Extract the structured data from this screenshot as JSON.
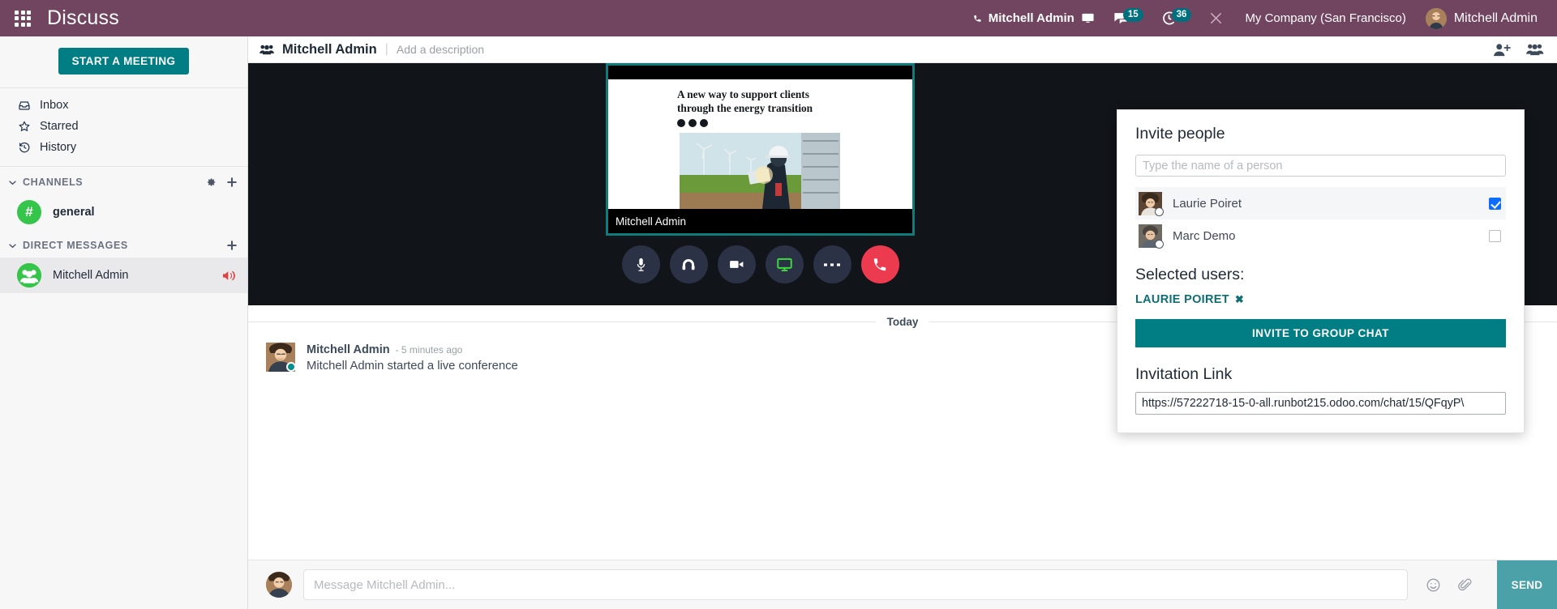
{
  "navbar": {
    "apps_icon": "apps-grid-icon",
    "brand": "Discuss",
    "phone_icon": "phone-icon",
    "ongoing_call_name": "Mitchell Admin",
    "monitor_icon": "monitor-icon",
    "messages_icon": "chat-bubble-icon",
    "messages_count": "15",
    "activities_icon": "clock-icon",
    "activities_count": "36",
    "debug_icon": "wrench-icon",
    "company": "My Company (San Francisco)",
    "user": "Mitchell Admin"
  },
  "sidebar": {
    "start_meeting_label": "START A MEETING",
    "mailboxes": [
      {
        "label": "Inbox",
        "icon": "inbox-icon"
      },
      {
        "label": "Starred",
        "icon": "star-icon"
      },
      {
        "label": "History",
        "icon": "history-icon"
      }
    ],
    "channels": {
      "title": "CHANNELS",
      "settings_icon": "gear-icon",
      "add_icon": "plus-icon",
      "items": [
        {
          "label": "general",
          "avatar_glyph": "#"
        }
      ]
    },
    "direct_messages": {
      "title": "DIRECT MESSAGES",
      "add_icon": "plus-icon",
      "items": [
        {
          "label": "Mitchell Admin",
          "mute_icon": "volume-mute-icon"
        }
      ]
    }
  },
  "thread": {
    "group_icon": "users-group-icon",
    "title": "Mitchell Admin",
    "description_placeholder": "Add a description",
    "add_member_icon": "add-user-icon",
    "member_list_icon": "users-icon"
  },
  "call": {
    "participant_name": "Mitchell Admin",
    "shared_slide": {
      "headline": "A new way to support clients through the energy transition",
      "social_icons": [
        "linkedin-icon",
        "share-icon",
        "facebook-icon"
      ]
    },
    "controls": [
      {
        "name": "microphone-button",
        "icon": "microphone-icon",
        "active": false
      },
      {
        "name": "headphones-button",
        "icon": "headphones-icon",
        "active": false
      },
      {
        "name": "camera-button",
        "icon": "video-camera-icon",
        "active": false
      },
      {
        "name": "screen-share-button",
        "icon": "monitor-icon",
        "active": true
      },
      {
        "name": "more-options-button",
        "icon": "ellipsis-icon",
        "active": false
      },
      {
        "name": "hangup-button",
        "icon": "phone-icon",
        "active": false
      }
    ],
    "accent_border": "#0e7c7b",
    "screen_share_active_color": "#3ddc3d",
    "hangup_color": "#ec3a4f"
  },
  "invite_panel": {
    "title": "Invite people",
    "search_placeholder": "Type the name of a person",
    "search_value": "",
    "people": [
      {
        "name": "Laurie Poiret",
        "checked": true
      },
      {
        "name": "Marc Demo",
        "checked": false
      }
    ],
    "selected_title": "Selected users:",
    "selected_chips": [
      {
        "label": "LAURIE POIRET",
        "remove_icon": "close-icon"
      }
    ],
    "invite_button_label": "INVITE TO GROUP CHAT",
    "link_title": "Invitation Link",
    "link_value": "https://57222718-15-0-all.runbot215.odoo.com/chat/15/QFqyP\\"
  },
  "messages": {
    "day_separator": "Today",
    "items": [
      {
        "author": "Mitchell Admin",
        "time": "- 5 minutes ago",
        "text": "Mitchell Admin started a live conference"
      }
    ]
  },
  "composer": {
    "placeholder": "Message Mitchell Admin...",
    "value": "",
    "emoji_icon": "smiley-icon",
    "attach_icon": "paperclip-icon",
    "send_label": "SEND"
  },
  "colors": {
    "navbar": "#71445f",
    "accent_teal": "#017e84",
    "badge": "#00707f",
    "send_button": "#4aa2a8",
    "channel_green": "#35c54a",
    "mute_red": "#e04040"
  }
}
